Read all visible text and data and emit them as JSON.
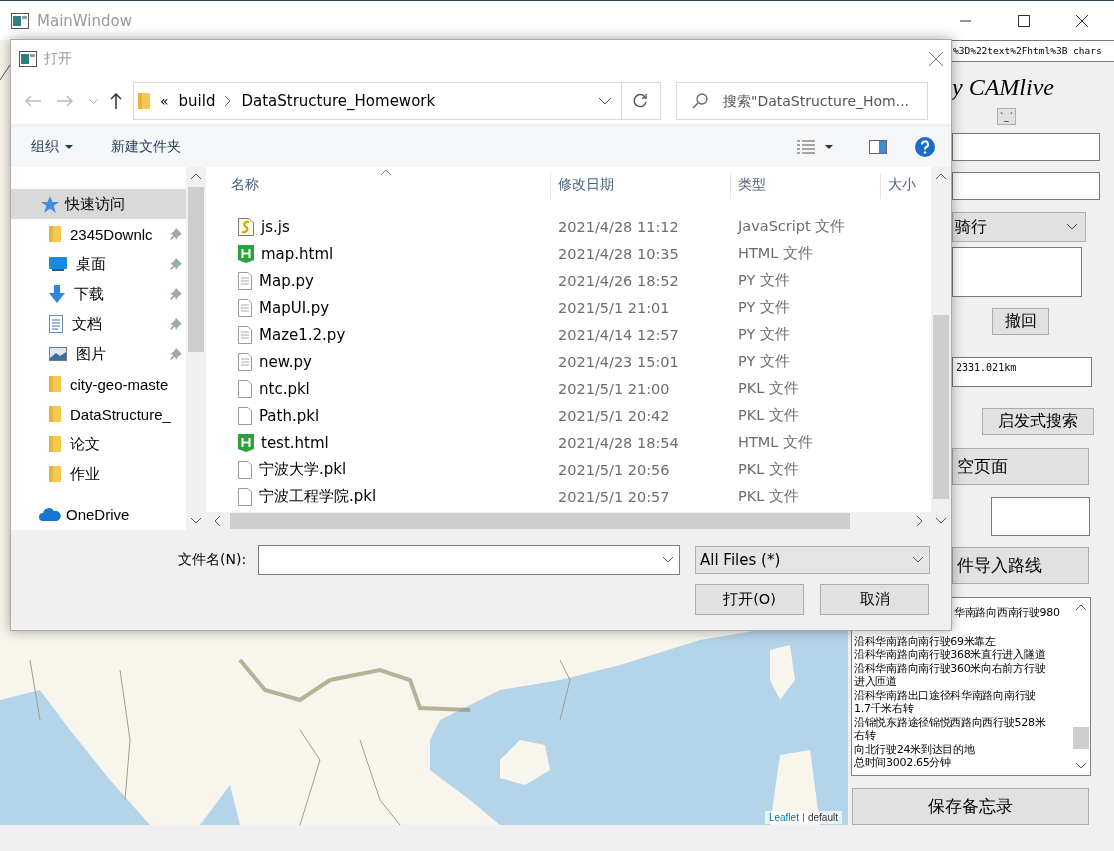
{
  "window": {
    "title": "MainWindow"
  },
  "url_field": {
    "value": "%3D%22text%2Fhtml%3B chars"
  },
  "app_title": "y CAMlive",
  "face_button": "`_´",
  "mode_select": {
    "value": "骑行"
  },
  "undo_button": "撤回",
  "distance_field": {
    "value": "2331.021km"
  },
  "heuristic_search_button": "启发式搜索",
  "clear_page_button": "空页面",
  "import_route_button": "件导入路线",
  "route_text": {
    "lines": [
      "华南路向西南行驶980",
      "沿科华南路向南行驶69米靠左",
      "沿科华南路向南行驶368米直行进入隧道",
      "沿科华南路向南行驶360米向右前方行驶",
      "进入匝道",
      "沿科华南路出口途径科华南路向南行驶",
      "1.7千米右转",
      "沿锦悦东路途径锦悦西路向西行驶528米",
      "右转",
      "向北行驶24米到达目的地",
      "总时间3002.65分钟"
    ]
  },
  "save_memo_button": "保存备忘录",
  "map": {
    "kind": "picture",
    "attribution_link": "Leaflet",
    "attribution_text": "default"
  },
  "dialog": {
    "title": "打开",
    "address": {
      "overflow": "«",
      "crumbs": [
        "build",
        "DataStructure_Homework"
      ]
    },
    "search": {
      "placeholder": "搜索\"DataStructure_Hom..."
    },
    "toolbar": {
      "organize": "组织",
      "new_folder": "新建文件夹"
    },
    "nav_items": [
      {
        "label": "快速访问",
        "kind": "star",
        "pinned": false,
        "selected": true
      },
      {
        "label": "2345Downlc",
        "kind": "folder",
        "pinned": true,
        "selected": false
      },
      {
        "label": "桌面",
        "kind": "desktop",
        "pinned": true,
        "selected": false
      },
      {
        "label": "下载",
        "kind": "download",
        "pinned": true,
        "selected": false
      },
      {
        "label": "文档",
        "kind": "document",
        "pinned": true,
        "selected": false
      },
      {
        "label": "图片",
        "kind": "pictures",
        "pinned": true,
        "selected": false
      },
      {
        "label": "city-geo-maste",
        "kind": "folder",
        "pinned": false,
        "selected": false
      },
      {
        "label": "DataStructure_",
        "kind": "folder",
        "pinned": false,
        "selected": false
      },
      {
        "label": "论文",
        "kind": "folder",
        "pinned": false,
        "selected": false
      },
      {
        "label": "作业",
        "kind": "folder",
        "pinned": false,
        "selected": false
      },
      {
        "label": "OneDrive",
        "kind": "cloud",
        "pinned": false,
        "selected": false
      }
    ],
    "columns": [
      "名称",
      "修改日期",
      "类型",
      "大小"
    ],
    "files": [
      {
        "name": "js.js",
        "kind": "js",
        "date": "2021/4/28 11:12",
        "type": "JavaScript 文件"
      },
      {
        "name": "map.html",
        "kind": "html",
        "date": "2021/4/28 10:35",
        "type": "HTML 文件"
      },
      {
        "name": "Map.py",
        "kind": "py",
        "date": "2021/4/26 18:52",
        "type": "PY 文件"
      },
      {
        "name": "MapUI.py",
        "kind": "py",
        "date": "2021/5/1 21:01",
        "type": "PY 文件"
      },
      {
        "name": "Maze1.2.py",
        "kind": "py",
        "date": "2021/4/14 12:57",
        "type": "PY 文件"
      },
      {
        "name": "new.py",
        "kind": "py",
        "date": "2021/4/23 15:01",
        "type": "PY 文件"
      },
      {
        "name": "ntc.pkl",
        "kind": "pkl",
        "date": "2021/5/1 21:00",
        "type": "PKL 文件"
      },
      {
        "name": "Path.pkl",
        "kind": "pkl",
        "date": "2021/5/1 20:42",
        "type": "PKL 文件"
      },
      {
        "name": "test.html",
        "kind": "html",
        "date": "2021/4/28 18:54",
        "type": "HTML 文件"
      },
      {
        "name": "宁波大学.pkl",
        "kind": "pkl",
        "date": "2021/5/1 20:56",
        "type": "PKL 文件"
      },
      {
        "name": "宁波工程学院.pkl",
        "kind": "pkl",
        "date": "2021/5/1 20:57",
        "type": "PKL 文件"
      }
    ],
    "filename_label": "文件名(N):",
    "filter": {
      "value": "All Files (*)"
    },
    "open_button": "打开(O)",
    "cancel_button": "取消"
  }
}
